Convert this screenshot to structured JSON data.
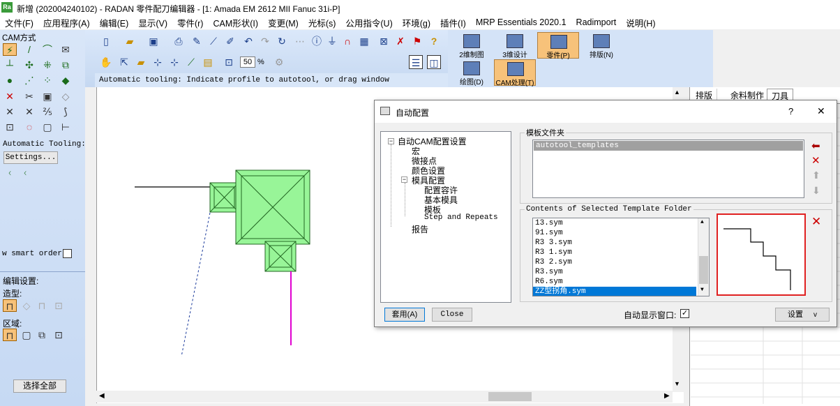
{
  "window": {
    "logo": "Ra",
    "title": "新增 (202004240102) - RADAN 零件配刀编辑器 - [1: Amada EM 2612 MII Fanuc 31i-P]"
  },
  "menu": [
    "文件(F)",
    "应用程序(A)",
    "编辑(E)",
    "显示(V)",
    "零件(r)",
    "CAM形状(I)",
    "变更(M)",
    "光标(s)",
    "公用指令(U)",
    "环境(g)",
    "插件(I)",
    "MRP Essentials 2020.1",
    "Radimport",
    "说明(H)"
  ],
  "left_panel": {
    "cam_header": "CAM方式",
    "auto_tooling_label": "Automatic Tooling:",
    "settings_button": "Settings...",
    "smart_order_label": "w smart order:",
    "edit_settings_label": "编辑设置:",
    "shape_label": "造型:",
    "region_label": "区域:",
    "select_all_button": "选择全部"
  },
  "toolbar": {
    "zoom_value": "50",
    "zoom_unit": "%",
    "status_message": "Automatic tooling: Indicate profile to autotool, or drag window"
  },
  "mode_buttons": [
    {
      "label": "2维制图",
      "active": false
    },
    {
      "label": "3维设计",
      "active": false
    },
    {
      "label": "零件(P)",
      "active": true
    },
    {
      "label": "排版(N)",
      "active": false
    },
    {
      "label": "绘图(D)",
      "active": false
    },
    {
      "label": "CAM处理(T)",
      "active": true
    }
  ],
  "right_panel": {
    "tabs": [
      "排版",
      "余料制作",
      "刀具"
    ]
  },
  "dialog": {
    "title": "自动配置",
    "help": "?",
    "close": "✕",
    "tree": {
      "root": "自动CAM配置设置",
      "items": [
        "宏",
        "微接点",
        "颜色设置",
        "模具配置",
        "配置容许",
        "基本模具",
        "模板",
        "Step and Repeats",
        "报告"
      ]
    },
    "template_folder_label": "模板文件夹",
    "template_folders": [
      "autotool_templates"
    ],
    "contents_label": "Contents of Selected Template Folder",
    "template_files": [
      "13.sym",
      "91.sym",
      "R3  3.sym",
      "R3 1.sym",
      "R3 2.sym",
      "R3.sym",
      "R6.sym",
      "ZZ型拐角.sym"
    ],
    "apply_button": "套用(A)",
    "close_button": "Close",
    "auto_show_label": "自动显示窗口:",
    "auto_show_checked": true,
    "settings_button": "设置",
    "settings_arrow": "v"
  }
}
